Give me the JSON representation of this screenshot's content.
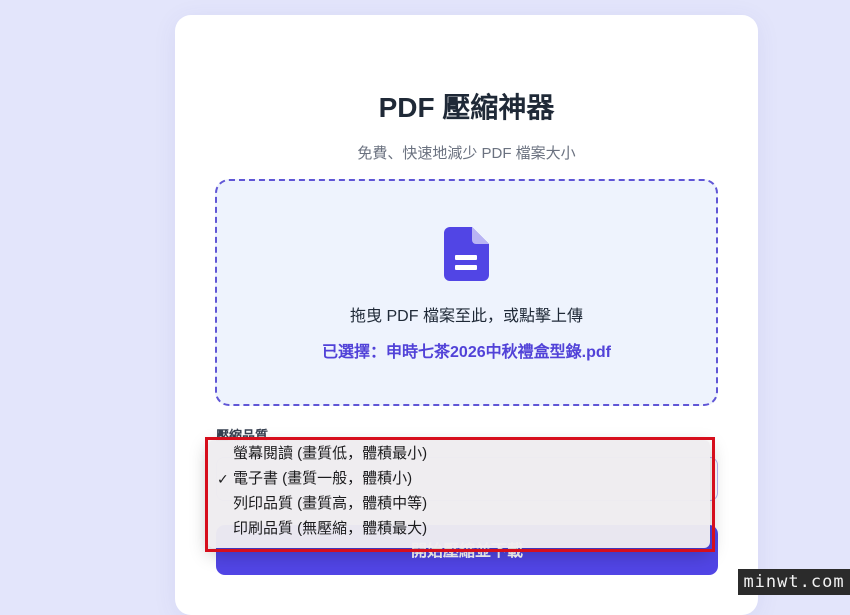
{
  "header": {
    "title": "PDF 壓縮神器",
    "subtitle": "免費、快速地減少 PDF 檔案大小"
  },
  "upload": {
    "icon": "document-icon",
    "instruction": "拖曳 PDF 檔案至此，或點擊上傳",
    "selected_file": "已選擇：申時七茶2026中秋禮盒型錄.pdf"
  },
  "quality": {
    "label": "壓縮品質",
    "selected": "電子書 (畫質一般，體積小)",
    "options": [
      {
        "label": "螢幕閱讀 (畫質低，體積最小)",
        "checked": false
      },
      {
        "label": "電子書 (畫質一般，體積小)",
        "checked": true
      },
      {
        "label": "列印品質 (畫質高，體積中等)",
        "checked": false
      },
      {
        "label": "印刷品質 (無壓縮，體積最大)",
        "checked": false
      }
    ],
    "check_mark": "✓"
  },
  "actions": {
    "compress_label": "開始壓縮並下載"
  },
  "watermark": "minwt.com",
  "colors": {
    "accent": "#5145e5",
    "dropzone_bg": "#eef3fd",
    "highlight": "#d60e1c"
  }
}
